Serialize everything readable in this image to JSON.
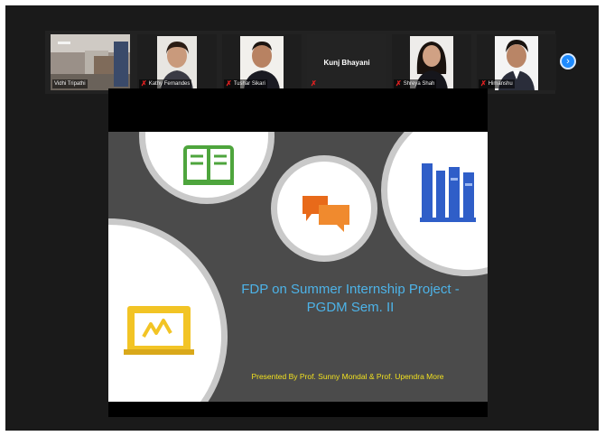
{
  "participants": [
    {
      "name": "Vidhi Tripathi",
      "muted": false,
      "kind": "room"
    },
    {
      "name": "Kathy Fernandes",
      "muted": true,
      "kind": "woman"
    },
    {
      "name": "Tushar Sikari",
      "muted": true,
      "kind": "man"
    },
    {
      "name": "Kunj Bhayani",
      "muted": true,
      "kind": "none"
    },
    {
      "name": "Shreya Shah",
      "muted": true,
      "kind": "woman2"
    },
    {
      "name": "Himanshu",
      "muted": true,
      "kind": "man2"
    }
  ],
  "next_page_icon": "chevron-right-icon",
  "slide": {
    "title_line1": "FDP on Summer Internship Project -",
    "title_line2": "PGDM Sem. II",
    "presenter": "Presented By Prof. Sunny Mondal & Prof. Upendra More"
  },
  "colors": {
    "slide_bg": "#4b4b4b",
    "title": "#4db3e8",
    "presenter": "#f0e020",
    "book_icon": "#4ea53d",
    "chat_icon": "#e86a1a",
    "library_icon": "#2f5ec8",
    "whiteboard_icon": "#f2c425"
  }
}
